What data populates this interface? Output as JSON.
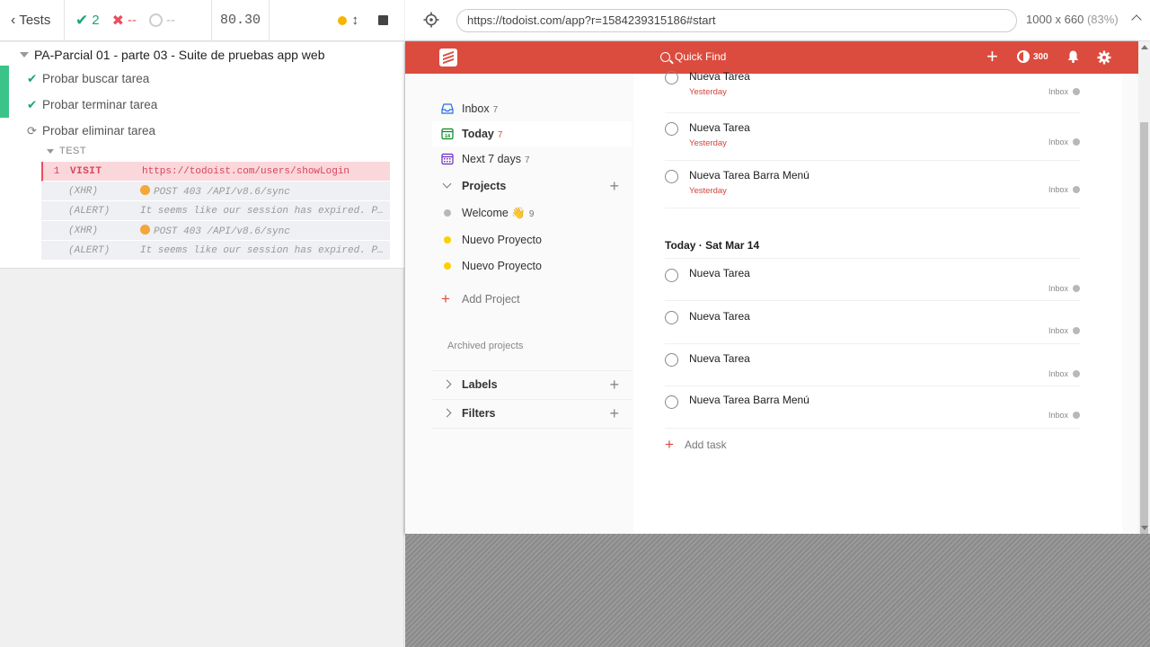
{
  "runner": {
    "back_label": "Tests",
    "passed": "2",
    "failed": "--",
    "pending": "--",
    "duration": "80.30",
    "suite_title": "PA-Parcial 01 - parte 03 - Suite de pruebas app web",
    "tests": [
      {
        "label": "Probar buscar tarea",
        "state": "passed"
      },
      {
        "label": "Probar terminar tarea",
        "state": "passed"
      },
      {
        "label": "Probar eliminar tarea",
        "state": "running"
      }
    ],
    "test_section_label": "TEST",
    "commands": [
      {
        "num": "1",
        "name": "VISIT",
        "msg": "https://todoist.com/users/showLogin"
      },
      {
        "num": "",
        "name": "(XHR)",
        "msg": "POST 403 /API/v8.6/sync"
      },
      {
        "num": "",
        "name": "(ALERT)",
        "msg": "It seems like our session has expired. P..."
      },
      {
        "num": "",
        "name": "(XHR)",
        "msg": "POST 403 /API/v8.6/sync"
      },
      {
        "num": "",
        "name": "(ALERT)",
        "msg": "It seems like our session has expired. P..."
      }
    ]
  },
  "browser": {
    "url": "https://todoist.com/app?r=1584239315186#start",
    "viewport": "1000 x 660",
    "zoom": "(83%)"
  },
  "todoist": {
    "brand_color": "#db4c3f",
    "search_placeholder": "Quick Find",
    "karma": "300",
    "nav": [
      {
        "label": "Inbox",
        "count": "7"
      },
      {
        "label": "Today",
        "count": "7"
      },
      {
        "label": "Next 7 days",
        "count": "7"
      }
    ],
    "projects_label": "Projects",
    "projects": [
      {
        "label": "Welcome 👋",
        "count": "9",
        "color": "#b8b8b8"
      },
      {
        "label": "Nuevo Proyecto",
        "count": "",
        "color": "#fad000"
      },
      {
        "label": "Nuevo Proyecto",
        "count": "",
        "color": "#fad000"
      }
    ],
    "add_project": "Add Project",
    "archived_projects": "Archived projects",
    "labels_label": "Labels",
    "filters_label": "Filters",
    "overdue_tasks": [
      {
        "name": "Nueva Tarea",
        "date": "Yesterday",
        "project": "Inbox"
      },
      {
        "name": "Nueva Tarea",
        "date": "Yesterday",
        "project": "Inbox"
      },
      {
        "name": "Nueva Tarea Barra Menú",
        "date": "Yesterday",
        "project": "Inbox"
      }
    ],
    "today_heading": "Today · Sat Mar 14",
    "today_tasks": [
      {
        "name": "Nueva Tarea",
        "project": "Inbox"
      },
      {
        "name": "Nueva Tarea",
        "project": "Inbox"
      },
      {
        "name": "Nueva Tarea",
        "project": "Inbox"
      },
      {
        "name": "Nueva Tarea Barra Menú",
        "project": "Inbox"
      }
    ],
    "add_task": "Add task"
  }
}
